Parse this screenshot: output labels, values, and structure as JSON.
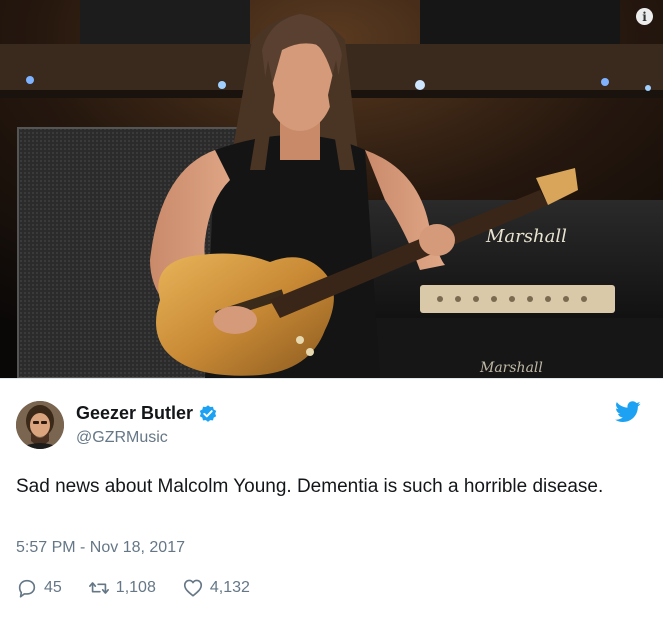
{
  "tweet": {
    "display_name": "Geezer Butler",
    "handle": "@GZRMusic",
    "text": "Sad news about Malcolm Young. Dementia is such a horrible disease.",
    "timestamp": "5:57 PM - Nov 18, 2017",
    "replies": "45",
    "retweets": "1,108",
    "likes": "4,132",
    "verified": true
  },
  "photo": {
    "amp_brand_top": "Marshall",
    "amp_brand_bottom": "Marshall",
    "info_icon": "i"
  },
  "icons": {
    "info": "info-icon",
    "verified": "verified-badge-icon",
    "bird": "twitter-bird-icon",
    "reply": "reply-icon",
    "retweet": "retweet-icon",
    "like": "heart-icon"
  },
  "colors": {
    "twitter_blue": "#1da1f2",
    "secondary_text": "#657786",
    "primary_text": "#14171a"
  }
}
